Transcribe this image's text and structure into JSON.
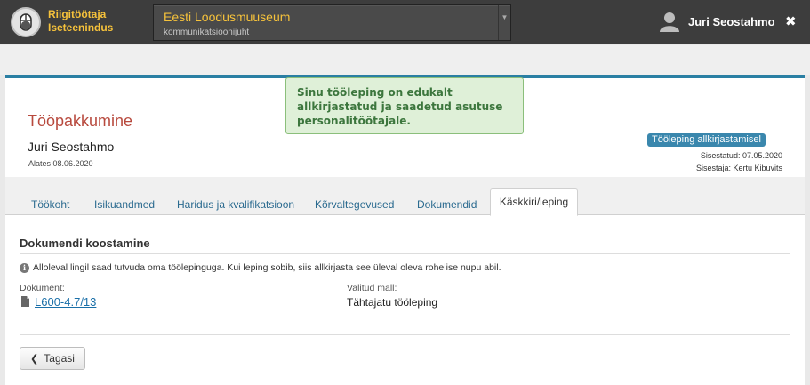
{
  "header": {
    "brand_line1": "Riigitöötaja",
    "brand_line2": "Iseteenindus",
    "org_name": "Eesti Loodusmuuseum",
    "org_role": "kommunikatsioonijuht",
    "user_name": "Juri Seostahmo",
    "close_label": "✖"
  },
  "notice": {
    "text": "Sinu tööleping on edukalt allkirjastatud ja saadetud asutuse personalitöötajale."
  },
  "offer": {
    "title": "Tööpakkumine",
    "person": "Juri Seostahmo",
    "since": "Alates 08.06.2020",
    "status_badge": "Tööleping allkirjastamisel",
    "submitted": "Sisestatud: 07.05.2020",
    "submitter": "Sisestaja: Kertu Kibuvits"
  },
  "tabs": [
    {
      "label": "Töökoht"
    },
    {
      "label": "Isikuandmed"
    },
    {
      "label": "Haridus ja kvalifikatsioon"
    },
    {
      "label": "Kõrvaltegevused"
    },
    {
      "label": "Dokumendid"
    },
    {
      "label": "Käskkiri/leping"
    }
  ],
  "section": {
    "title": "Dokumendi koostamine",
    "info": "Alloleval lingil saad tutvuda oma töölepinguga. Kui leping sobib, siis allkirjasta see üleval oleva rohelise nupu abil.",
    "document_label": "Dokument:",
    "document_link": "L600-4.7/13",
    "template_label": "Valitud mall:",
    "template_value": "Tähtajatu tööleping"
  },
  "actions": {
    "back_label": "Tagasi"
  },
  "colors": {
    "brand_yellow": "#f6c23b",
    "title_red": "#b84a3e",
    "badge_blue": "#3a87ad",
    "notice_green": "#dff0d8"
  }
}
